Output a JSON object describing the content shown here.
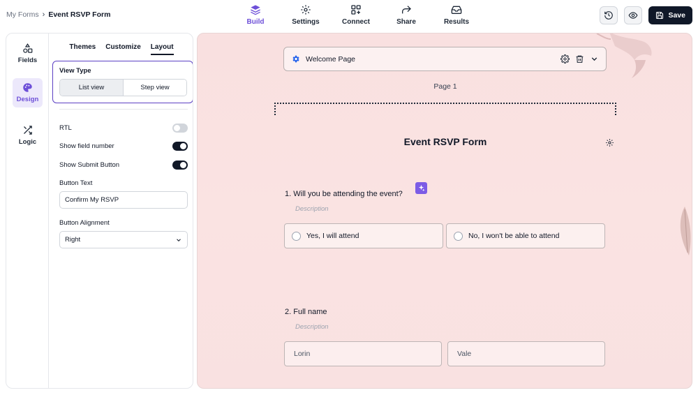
{
  "breadcrumb": {
    "root": "My Forms",
    "separator": "›",
    "current": "Event RSVP Form"
  },
  "nav": [
    {
      "label": "Build",
      "icon": "layers-icon",
      "active": true
    },
    {
      "label": "Settings",
      "icon": "gear-icon",
      "active": false
    },
    {
      "label": "Connect",
      "icon": "connect-icon",
      "active": false
    },
    {
      "label": "Share",
      "icon": "share-icon",
      "active": false
    },
    {
      "label": "Results",
      "icon": "inbox-icon",
      "active": false
    }
  ],
  "actions": {
    "history_icon": "history-icon",
    "preview_icon": "eye-icon",
    "save_label": "Save"
  },
  "rail": [
    {
      "label": "Fields",
      "icon": "shapes-icon",
      "active": false
    },
    {
      "label": "Design",
      "icon": "palette-icon",
      "active": true
    },
    {
      "label": "Logic",
      "icon": "shuffle-icon",
      "active": false
    }
  ],
  "subtabs": [
    {
      "label": "Themes",
      "active": false
    },
    {
      "label": "Customize",
      "active": false
    },
    {
      "label": "Layout",
      "active": true
    }
  ],
  "layout": {
    "view_type_label": "View Type",
    "view_options": [
      "List view",
      "Step view"
    ],
    "selected_view": "List view",
    "rtl_label": "RTL",
    "rtl_on": false,
    "show_field_number_label": "Show field number",
    "show_field_number_on": true,
    "show_submit_label": "Show Submit Button",
    "show_submit_on": true,
    "button_text_label": "Button Text",
    "button_text_value": "Confirm My RSVP",
    "button_alignment_label": "Button Alignment",
    "button_alignment_value": "Right"
  },
  "canvas": {
    "welcome_label": "Welcome Page",
    "page_label": "Page 1",
    "form_title": "Event RSVP Form",
    "questions": [
      {
        "number": "1.",
        "text": "Will you be attending the event?",
        "description": "Description",
        "options": [
          "Yes, I will attend",
          "No, I won't be able to attend"
        ]
      },
      {
        "number": "2.",
        "text": "Full name",
        "description": "Description",
        "inputs": [
          "Lorin",
          "Vale"
        ]
      }
    ]
  },
  "colors": {
    "accent": "#6d4fd8",
    "dark": "#101828",
    "canvas_bg": "#fae3e2",
    "focus_border": "#5b3fc4"
  }
}
